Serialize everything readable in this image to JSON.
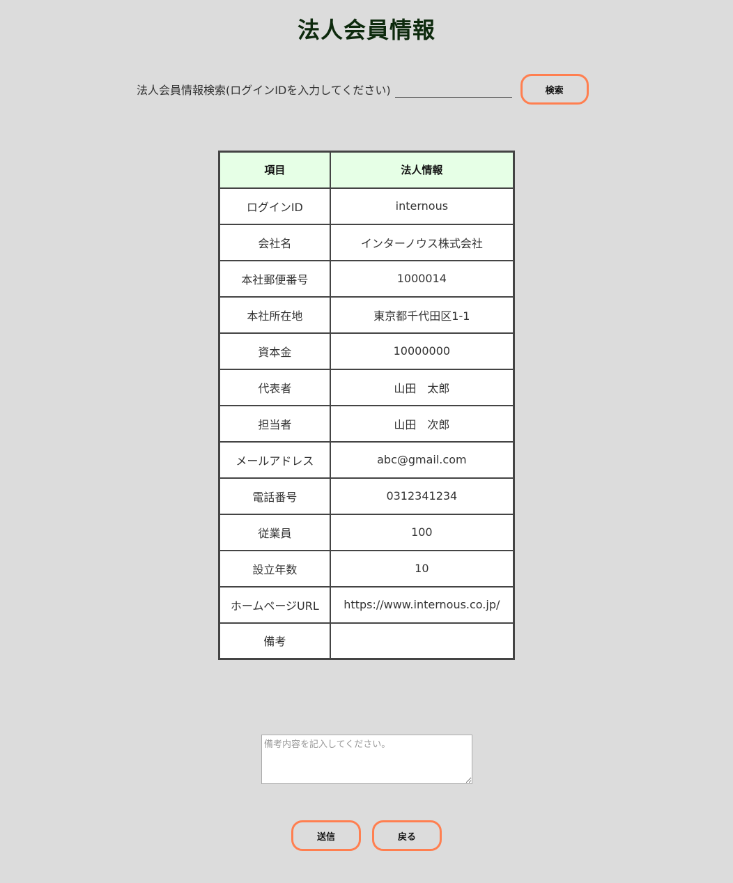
{
  "title": "法人会員情報",
  "search": {
    "label": "法人会員情報検索(ログインIDを入力してください)",
    "value": "",
    "placeholder": "",
    "button_label": "検索"
  },
  "table": {
    "headers": [
      "項目",
      "法人情報"
    ],
    "rows": [
      {
        "label": "ログインID",
        "value": "internous"
      },
      {
        "label": "会社名",
        "value": "インターノウス株式会社"
      },
      {
        "label": "本社郵便番号",
        "value": "1000014"
      },
      {
        "label": "本社所在地",
        "value": "東京都千代田区1-1"
      },
      {
        "label": "資本金",
        "value": "10000000"
      },
      {
        "label": "代表者",
        "value": "山田　太郎"
      },
      {
        "label": "担当者",
        "value": "山田　次郎"
      },
      {
        "label": "メールアドレス",
        "value": "abc@gmail.com"
      },
      {
        "label": "電話番号",
        "value": "0312341234"
      },
      {
        "label": "従業員",
        "value": "100"
      },
      {
        "label": "設立年数",
        "value": "10"
      },
      {
        "label": "ホームページURL",
        "value": "https://www.internous.co.jp/"
      },
      {
        "label": "備考",
        "value": ""
      }
    ]
  },
  "remarks": {
    "placeholder": "備考内容を記入してください。",
    "value": ""
  },
  "buttons": {
    "submit_label": "送信",
    "back_label": "戻る"
  },
  "colors": {
    "background": "#dcdcdc",
    "button_border": "#ff7f50",
    "header_bg": "#e6ffe6",
    "title": "#0d2a0d"
  }
}
